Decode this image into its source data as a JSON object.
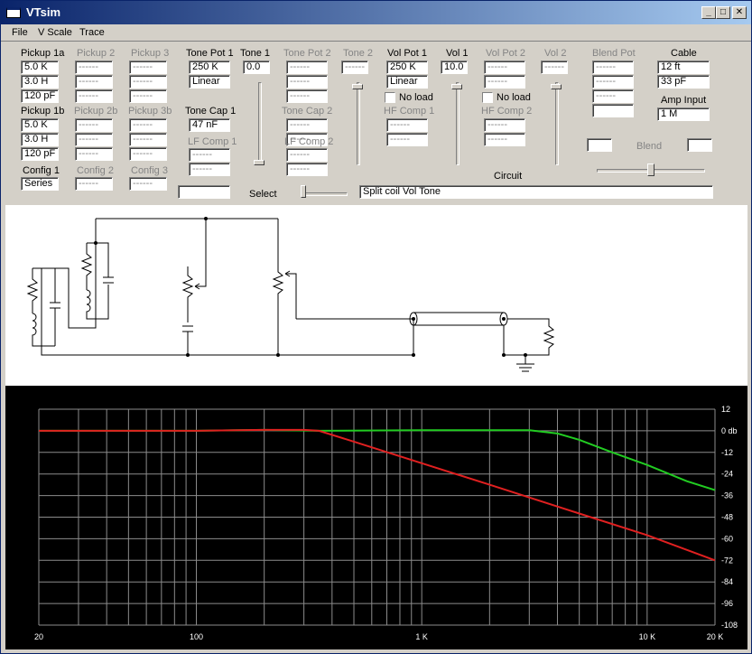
{
  "window": {
    "title": "VTsim"
  },
  "titlebar_buttons": {
    "minimize": "_",
    "maximize": "□",
    "close": "✕"
  },
  "menu": [
    "File",
    "V Scale",
    "Trace"
  ],
  "pickup1a": {
    "label": "Pickup 1a",
    "values": [
      "5.0 K",
      "3.0 H",
      "120 pF"
    ]
  },
  "pickup2": {
    "label": "Pickup 2",
    "values": [
      "------",
      "------",
      "------"
    ]
  },
  "pickup3": {
    "label": "Pickup 3",
    "values": [
      "------",
      "------",
      "------"
    ]
  },
  "pickup1b": {
    "label": "Pickup 1b",
    "values": [
      "5.0 K",
      "3.0 H",
      "120 pF"
    ]
  },
  "pickup2b": {
    "label": "Pickup 2b",
    "values": [
      "------",
      "------",
      "------"
    ]
  },
  "pickup3b": {
    "label": "Pickup 3b",
    "values": [
      "------",
      "------",
      "------"
    ]
  },
  "config1": {
    "label": "Config 1",
    "value": "Series"
  },
  "config2": {
    "label": "Config 2",
    "value": "------"
  },
  "config3": {
    "label": "Config 3",
    "value": "------"
  },
  "tone_pot1": {
    "label": "Tone Pot 1",
    "values": [
      "250 K",
      "Linear"
    ]
  },
  "tone1": {
    "label": "Tone 1",
    "value": "0.0"
  },
  "tone_pot2": {
    "label": "Tone Pot 2",
    "values": [
      "------",
      "------",
      "------"
    ]
  },
  "tone2": {
    "label": "Tone 2",
    "value": "------"
  },
  "tone_cap1": {
    "label": "Tone Cap 1",
    "value": "47 nF"
  },
  "tone_cap2": {
    "label": "Tone Cap 2",
    "values": [
      "------",
      "------"
    ]
  },
  "lf_comp1": {
    "label": "LF Comp 1",
    "values": [
      "------",
      "------"
    ]
  },
  "lf_comp2": {
    "label": "LF Comp 2",
    "values": [
      "------",
      "------"
    ]
  },
  "vol_pot1": {
    "label": "Vol Pot 1",
    "values": [
      "250 K",
      "Linear"
    ],
    "no_load": "No load"
  },
  "vol1": {
    "label": "Vol 1",
    "value": "10.0"
  },
  "vol_pot2": {
    "label": "Vol Pot 2",
    "values": [
      "------",
      "------"
    ],
    "no_load": "No load"
  },
  "vol2": {
    "label": "Vol 2",
    "value": "------"
  },
  "hf_comp1": {
    "label": "HF Comp 1",
    "values": [
      "------",
      "------"
    ]
  },
  "hf_comp2": {
    "label": "HF Comp 2",
    "values": [
      "------",
      "------"
    ]
  },
  "blend_pot": {
    "label": "Blend Pot",
    "values": [
      "------",
      "------",
      "------",
      ""
    ]
  },
  "cable": {
    "label": "Cable",
    "values": [
      "12 ft",
      "33 pF"
    ]
  },
  "amp_input": {
    "label": "Amp Input",
    "value": "1 M"
  },
  "blend": {
    "label": "Blend",
    "left": "",
    "right": ""
  },
  "select": {
    "label": "Select",
    "value": ""
  },
  "circuit": {
    "label": "Circuit",
    "value": "Split coil   Vol   Tone"
  },
  "colors": {
    "green_trace": "#22cc22",
    "red_trace": "#e02020",
    "grid": "#8c8c8c"
  },
  "chart_data": {
    "type": "line",
    "xscale": "log",
    "xlim": [
      20,
      20000
    ],
    "ylim": [
      -108,
      12
    ],
    "x_ticks": [
      {
        "value": 20,
        "label": "20"
      },
      {
        "value": 100,
        "label": "100"
      },
      {
        "value": 1000,
        "label": "1 K"
      },
      {
        "value": 10000,
        "label": "10 K"
      },
      {
        "value": 20000,
        "label": "20 K"
      }
    ],
    "y_ticks": [
      {
        "value": 12,
        "label": "12"
      },
      {
        "value": 0,
        "label": "0 db"
      },
      {
        "value": -12,
        "label": "-12"
      },
      {
        "value": -24,
        "label": "-24"
      },
      {
        "value": -36,
        "label": "-36"
      },
      {
        "value": -48,
        "label": "-48"
      },
      {
        "value": -60,
        "label": "-60"
      },
      {
        "value": -72,
        "label": "-72"
      },
      {
        "value": -84,
        "label": "-84"
      },
      {
        "value": -96,
        "label": "-96"
      },
      {
        "value": -108,
        "label": "-108"
      }
    ],
    "grid": true,
    "series": [
      {
        "color": "#22cc22",
        "x": [
          20,
          100,
          200,
          350,
          1000,
          2000,
          3000,
          4000,
          5000,
          7000,
          10000,
          15000,
          20000
        ],
        "y": [
          0,
          0,
          0.5,
          0,
          0.3,
          0.3,
          0.3,
          -1.5,
          -5,
          -12,
          -19,
          -28,
          -33
        ]
      },
      {
        "color": "#e02020",
        "x": [
          20,
          100,
          200,
          300,
          350,
          500,
          1000,
          2000,
          5000,
          10000,
          20000
        ],
        "y": [
          0,
          0,
          0.5,
          0.5,
          0,
          -6,
          -18,
          -30,
          -46,
          -58,
          -72
        ]
      }
    ]
  }
}
